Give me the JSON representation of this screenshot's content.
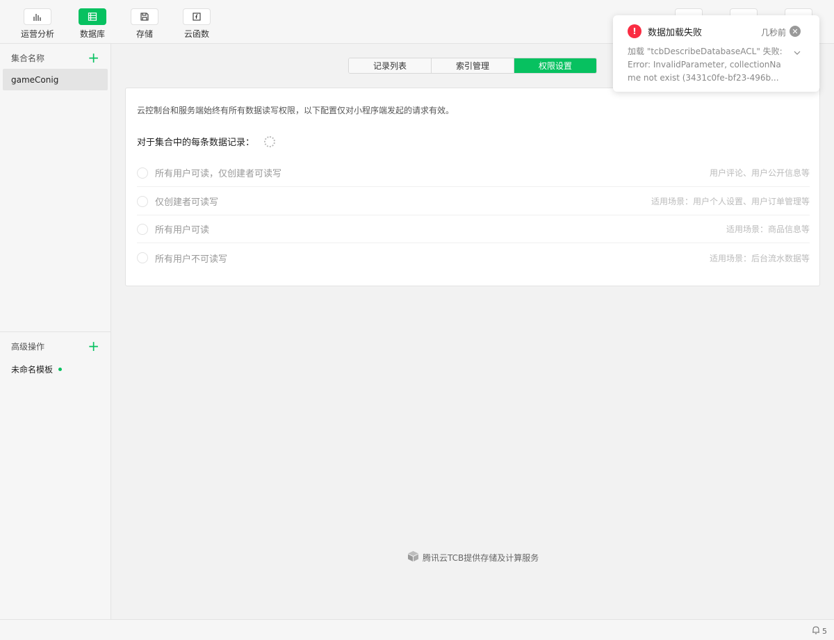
{
  "toolbar": {
    "items": [
      {
        "label": "运营分析",
        "icon": "bar-chart-icon",
        "active": false
      },
      {
        "label": "数据库",
        "icon": "database-icon",
        "active": true
      },
      {
        "label": "存储",
        "icon": "save-icon",
        "active": false
      },
      {
        "label": "云函数",
        "icon": "function-icon",
        "active": false
      }
    ]
  },
  "sidebar": {
    "collections_title": "集合名称",
    "collections": [
      "gameConig"
    ],
    "advanced_title": "高级操作",
    "templates": [
      "未命名模板"
    ]
  },
  "tabs": [
    {
      "label": "记录列表",
      "active": false
    },
    {
      "label": "索引管理",
      "active": false
    },
    {
      "label": "权限设置",
      "active": true
    }
  ],
  "permission": {
    "description": "云控制台和服务端始终有所有数据读写权限，以下配置仅对小程序端发起的请求有效。",
    "label": "对于集合中的每条数据记录：",
    "options": [
      {
        "label": "所有用户可读，仅创建者可读写",
        "hint": "用户评论、用户公开信息等"
      },
      {
        "label": "仅创建者可读写",
        "hint": "适用场景：用户个人设置、用户订单管理等"
      },
      {
        "label": "所有用户可读",
        "hint": "适用场景：商品信息等"
      },
      {
        "label": "所有用户不可读写",
        "hint": "适用场景：后台流水数据等"
      }
    ]
  },
  "footer": {
    "credit": "腾讯云TCB提供存储及计算服务"
  },
  "statusbar": {
    "notification_count": "5"
  },
  "toast": {
    "title": "数据加载失败",
    "time": "几秒前",
    "message": "加载 \"tcbDescribeDatabaseACL\" 失败:Error: InvalidParameter, collectionName not exist (3431c0fe-bf23-496b...",
    "icon": "error-icon"
  },
  "colors": {
    "accent": "#07c160",
    "error": "#fa2c42"
  }
}
